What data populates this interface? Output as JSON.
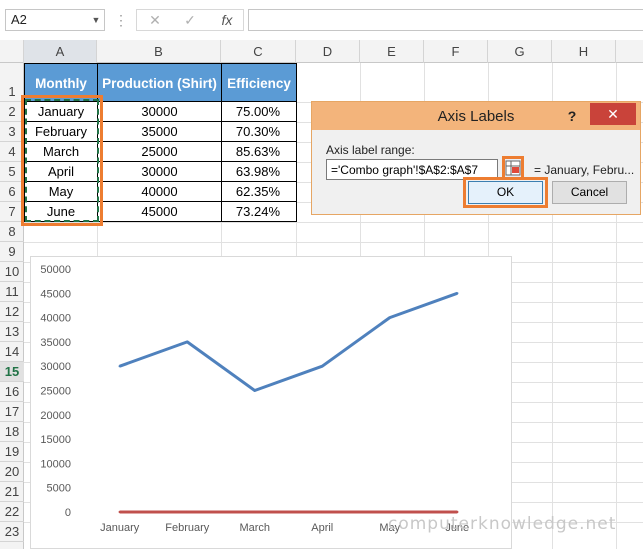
{
  "formula_bar": {
    "name_box": "A2",
    "cancel_glyph": "✕",
    "enter_glyph": "✓",
    "fx_glyph": "fx",
    "formula": ""
  },
  "columns": [
    "A",
    "B",
    "C",
    "D",
    "E",
    "F",
    "G",
    "H"
  ],
  "rows": [
    "1",
    "2",
    "3",
    "4",
    "5",
    "6",
    "7",
    "8",
    "9",
    "10",
    "11",
    "12",
    "13",
    "14",
    "15",
    "16",
    "17",
    "18",
    "19",
    "20",
    "21",
    "22",
    "23"
  ],
  "active_row": "15",
  "table": {
    "headers": [
      "Monthly",
      "Production (Shirt)",
      "Efficiency"
    ],
    "data": [
      [
        "January",
        "30000",
        "75.00%"
      ],
      [
        "February",
        "35000",
        "70.30%"
      ],
      [
        "March",
        "25000",
        "85.63%"
      ],
      [
        "April",
        "30000",
        "63.98%"
      ],
      [
        "May",
        "40000",
        "62.35%"
      ],
      [
        "June",
        "45000",
        "73.24%"
      ]
    ]
  },
  "chart_data": {
    "type": "line",
    "categories": [
      "January",
      "February",
      "March",
      "April",
      "May",
      "June"
    ],
    "series": [
      {
        "values": [
          30000,
          35000,
          25000,
          30000,
          40000,
          45000
        ],
        "color": "#4f81bd"
      },
      {
        "values": [
          0.75,
          0.703,
          0.8563,
          0.6398,
          0.6235,
          0.7324
        ],
        "color": "#c0504d"
      }
    ],
    "yticks": [
      "50000",
      "45000",
      "40000",
      "35000",
      "30000",
      "25000",
      "20000",
      "15000",
      "10000",
      "5000",
      "0"
    ],
    "ylim": [
      0,
      50000
    ],
    "grid": false
  },
  "dialog": {
    "title": "Axis Labels",
    "help": "?",
    "close": "✕",
    "range_label": "Axis label range:",
    "range_value": "='Combo graph'!$A$2:$A$7",
    "range_preview": "= January, Febru...",
    "ok": "OK",
    "cancel": "Cancel"
  },
  "colors": {
    "header_blue": "#5b9bd5",
    "highlight_orange": "#ed7d31",
    "marquee_green": "#217346"
  },
  "watermark": "computerknowledge.net"
}
